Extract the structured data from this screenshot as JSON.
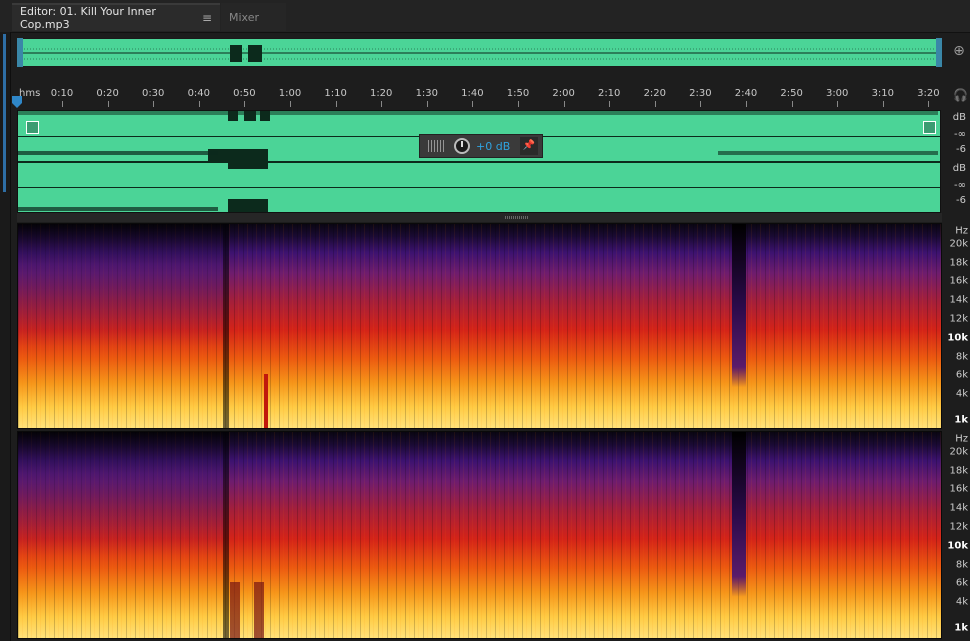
{
  "tabs": {
    "editor_label": "Editor: 01. Kill Your Inner Cop.mp3",
    "menu_glyph": "≡",
    "mixer_label": "Mixer"
  },
  "ruler": {
    "unit": "hms",
    "ticks": [
      "0:10",
      "0:20",
      "0:30",
      "0:40",
      "0:50",
      "1:00",
      "1:10",
      "1:20",
      "1:30",
      "1:40",
      "1:50",
      "2:00",
      "2:10",
      "2:20",
      "2:30",
      "2:40",
      "2:50",
      "3:00",
      "3:10",
      "3:20"
    ]
  },
  "waveform": {
    "channel1": {
      "db_label": "dB",
      "inf": "-∞",
      "minus6": "-6"
    },
    "channel2": {
      "db_label": "dB",
      "inf": "-∞",
      "minus6": "-6"
    },
    "color": "#4bd497"
  },
  "hud": {
    "gain": "+0 dB"
  },
  "spectral": {
    "unit": "Hz",
    "labels": [
      "20k",
      "18k",
      "16k",
      "14k",
      "12k",
      "10k",
      "8k",
      "6k",
      "4k",
      "1k"
    ]
  },
  "icons": {
    "zoom": "zoom-icon",
    "headphones": "headphones-icon",
    "pin": "pin-icon"
  }
}
